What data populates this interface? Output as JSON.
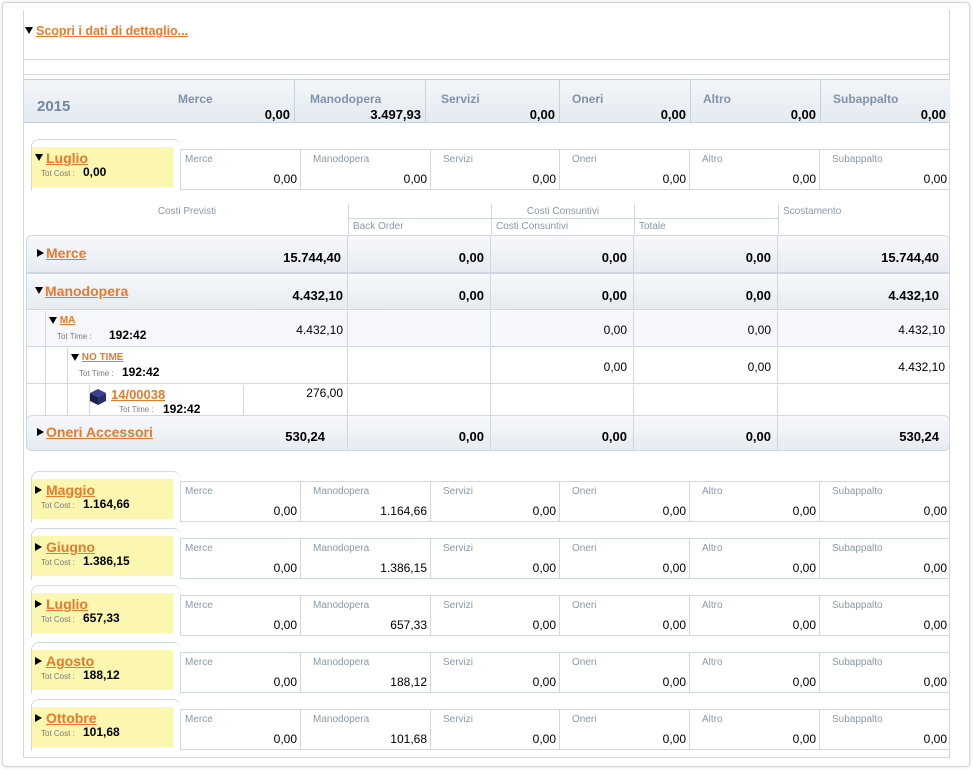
{
  "discover_link": "Scopri i dati di dettaglio...",
  "year": {
    "label": "2015",
    "cells": [
      {
        "label": "Merce",
        "value": "0,00"
      },
      {
        "label": "Manodopera",
        "value": "3.497,93"
      },
      {
        "label": "Servizi",
        "value": "0,00"
      },
      {
        "label": "Oneri",
        "value": "0,00"
      },
      {
        "label": "Altro",
        "value": "0,00"
      },
      {
        "label": "Subappalto",
        "value": "0,00"
      }
    ]
  },
  "tot_cost_label": "Tot Cost :",
  "tot_time_label": "Tot Time :",
  "expanded_month": {
    "name": "Luglio",
    "tot_cost": "0,00",
    "values": [
      "0,00",
      "0,00",
      "0,00",
      "0,00",
      "0,00",
      "0,00"
    ]
  },
  "cost_labels": [
    "Merce",
    "Manodopera",
    "Servizi",
    "Oneri",
    "Altro",
    "Subappalto"
  ],
  "detail_header": {
    "costi_previsti": "Costi Previsti",
    "costi_consuntivi": "Costi Consuntivi",
    "back_order": "Back Order",
    "costi_consuntivi_sub": "Costi Consuntivi",
    "totale": "Totale",
    "scostamento": "Scostamento"
  },
  "detail": {
    "merce": {
      "name": "Merce",
      "values": [
        "15.744,40",
        "0,00",
        "0,00",
        "0,00",
        "15.744,40"
      ]
    },
    "manodopera": {
      "name": "Manodopera",
      "values": [
        "4.432,10",
        "0,00",
        "0,00",
        "0,00",
        "4.432,10"
      ]
    },
    "ma": {
      "name": "MA",
      "tot_time": "192:42",
      "values": [
        "4.432,10",
        "",
        "0,00",
        "0,00",
        "4.432,10"
      ]
    },
    "no_time": {
      "name": "NO TIME",
      "tot_time": "192:42",
      "values": [
        "",
        "",
        "0,00",
        "0,00",
        "4.432,10"
      ]
    },
    "item": {
      "name": "14/00038",
      "tot_time": "192:42",
      "value": "276,00"
    },
    "oneri": {
      "name": "Oneri Accessori",
      "values": [
        "530,24",
        "0,00",
        "0,00",
        "0,00",
        "530,24"
      ]
    }
  },
  "months": [
    {
      "name": "Maggio",
      "tot_cost": "1.164,66",
      "values": [
        "0,00",
        "1.164,66",
        "0,00",
        "0,00",
        "0,00",
        "0,00"
      ]
    },
    {
      "name": "Giugno",
      "tot_cost": "1.386,15",
      "values": [
        "0,00",
        "1.386,15",
        "0,00",
        "0,00",
        "0,00",
        "0,00"
      ]
    },
    {
      "name": "Luglio",
      "tot_cost": "657,33",
      "values": [
        "0,00",
        "657,33",
        "0,00",
        "0,00",
        "0,00",
        "0,00"
      ]
    },
    {
      "name": "Agosto",
      "tot_cost": "188,12",
      "values": [
        "0,00",
        "188,12",
        "0,00",
        "0,00",
        "0,00",
        "0,00"
      ]
    },
    {
      "name": "Ottobre",
      "tot_cost": "101,68",
      "values": [
        "0,00",
        "101,68",
        "0,00",
        "0,00",
        "0,00",
        "0,00"
      ]
    }
  ]
}
